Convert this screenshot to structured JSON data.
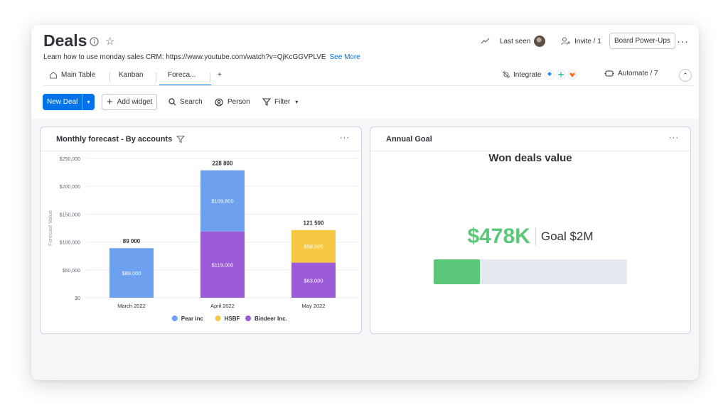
{
  "board": {
    "title": "Deals",
    "description": "Learn how to use monday sales CRM: https://www.youtube.com/watch?v=QjKcGGVPLVE",
    "see_more": "See More"
  },
  "header_right": {
    "last_seen": "Last seen",
    "invite": "Invite / 1",
    "power_ups": "Board Power-Ups"
  },
  "tabs": [
    {
      "label": "Main Table",
      "icon": "home-icon"
    },
    {
      "label": "Kanban"
    },
    {
      "label": "Foreca...",
      "active": true
    },
    {
      "label": "+"
    }
  ],
  "integrations": {
    "integrate": "Integrate",
    "automate": "Automate / 7"
  },
  "toolbar": {
    "new_deal": "New Deal",
    "add_widget": "Add widget",
    "search": "Search",
    "person": "Person",
    "filter": "Filter"
  },
  "forecast_widget": {
    "title": "Monthly forecast - By accounts"
  },
  "annual_goal": {
    "title": "Annual Goal",
    "subtitle": "Won deals value",
    "value": "$478K",
    "goal": "Goal $2M",
    "progress_fraction": 0.239
  },
  "colors": {
    "accent": "#0073ea",
    "won_green": "#5ac878",
    "pear": "#6ea0f0",
    "hsbf": "#f7c843",
    "bindeer": "#9b5bd8"
  },
  "chart_data": {
    "type": "bar",
    "stacked": true,
    "categories": [
      "March 2022",
      "April 2022",
      "May 2022"
    ],
    "series": [
      {
        "name": "Bindeer Inc.",
        "values": [
          0,
          119000,
          63000
        ],
        "labels": [
          "",
          "$119,000",
          "$63,000"
        ]
      },
      {
        "name": "Pear inc",
        "values": [
          89000,
          109800,
          0
        ],
        "labels": [
          "$89,000",
          "$109,800",
          ""
        ]
      },
      {
        "name": "HSBF",
        "values": [
          0,
          0,
          58500
        ],
        "labels": [
          "",
          "",
          "$58,500"
        ]
      }
    ],
    "legend_order": [
      "Pear inc",
      "HSBF",
      "Bindeer Inc."
    ],
    "totals": [
      "89 000",
      "228 800",
      "121 500"
    ],
    "ylabel": "Forecast Value",
    "ylim": [
      0,
      250000
    ],
    "yticks": [
      0,
      50000,
      100000,
      150000,
      200000,
      250000
    ],
    "ytick_labels": [
      "$0",
      "$50,000",
      "$100,000",
      "$150,000",
      "$200,000",
      "$250,000"
    ],
    "legend": "bottom",
    "grid": true
  }
}
